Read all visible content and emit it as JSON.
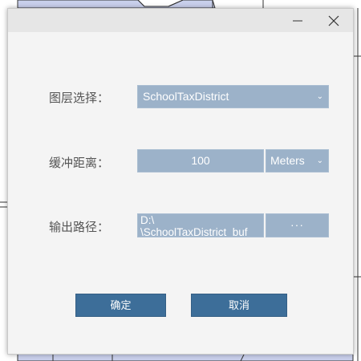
{
  "window": {
    "minimize_glyph": "—",
    "close_glyph": "✕"
  },
  "form": {
    "layer_label": "图层选择：",
    "layer_value": "SchoolTaxDistrict",
    "distance_label": "缓冲距离：",
    "distance_value": "100",
    "unit_value": "Meters",
    "output_label": "输出路径：",
    "output_path_line1": "D:\\",
    "output_path_line2": "\\SchoolTaxDistrict_buf",
    "browse_label": "···"
  },
  "buttons": {
    "ok_label": "确定",
    "cancel_label": "取消"
  },
  "icons": {
    "dropdown": "chevron-down-icon"
  },
  "colors": {
    "field_bg": "#9cb2c9",
    "button_bg": "#3d6e99",
    "dialog_bg": "#f4f4f4",
    "titlebar_bg": "#e6e6e6",
    "map_fill": "#c9d0ec"
  }
}
